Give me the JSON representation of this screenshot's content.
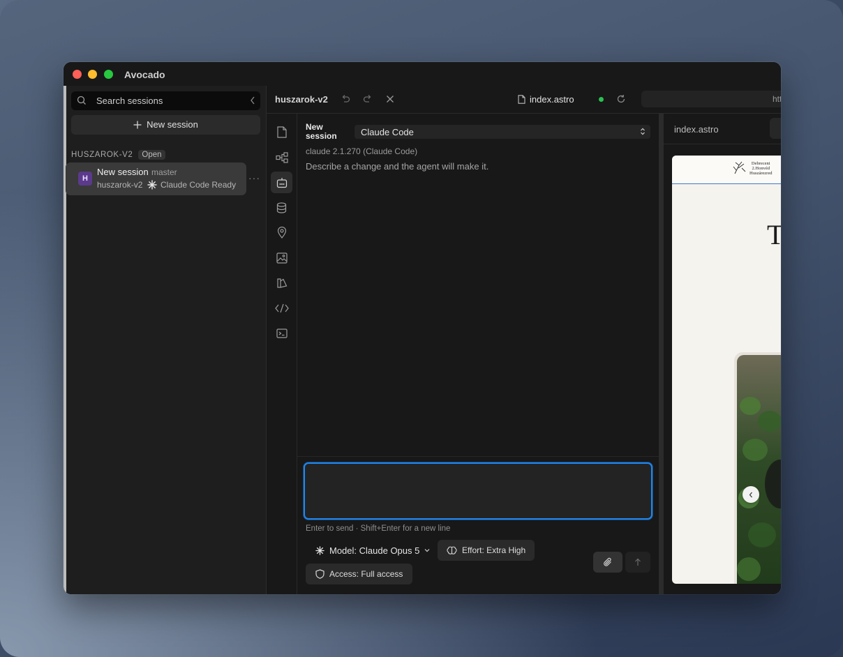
{
  "app": {
    "title": "Avocado"
  },
  "sidebar": {
    "search_placeholder": "Search sessions",
    "new_session_label": "New session",
    "group": {
      "name": "HUSZAROK-V2",
      "badge": "Open"
    },
    "sessions": [
      {
        "avatar": "H",
        "title": "New session",
        "branch": "master",
        "project": "huszarok-v2",
        "status": "Claude Code Ready",
        "status_icon": "claude-sparkle-icon"
      }
    ],
    "more_label": "···"
  },
  "header": {
    "project_name": "huszarok-v2",
    "file_tab": "index.astro",
    "url_text": "http",
    "status_color": "#29c150"
  },
  "rail": {
    "items": [
      "file-icon",
      "graph-icon",
      "agent-icon",
      "database-icon",
      "location-icon",
      "image-icon",
      "swatch-icon",
      "code-icon",
      "terminal-icon"
    ],
    "active": "agent-icon"
  },
  "chat": {
    "session_label": "New session",
    "agent_selected": "Claude Code",
    "version": "claude 2.1.270 (Claude Code)",
    "hint": "Describe a change and the agent will make it.",
    "composer_value": "",
    "send_hint": "Enter to send · Shift+Enter for a new line",
    "model_label": "Model: Claude Opus 5",
    "effort_label": "Effort: Extra High",
    "access_label": "Access: Full access",
    "accent_color": "#1f87f0"
  },
  "preview": {
    "tab_label": "index.astro",
    "site_logo_lines": [
      "Debreceni",
      "2.Honvéd",
      "Huszárezred"
    ],
    "site_heading_fragment": "T"
  }
}
